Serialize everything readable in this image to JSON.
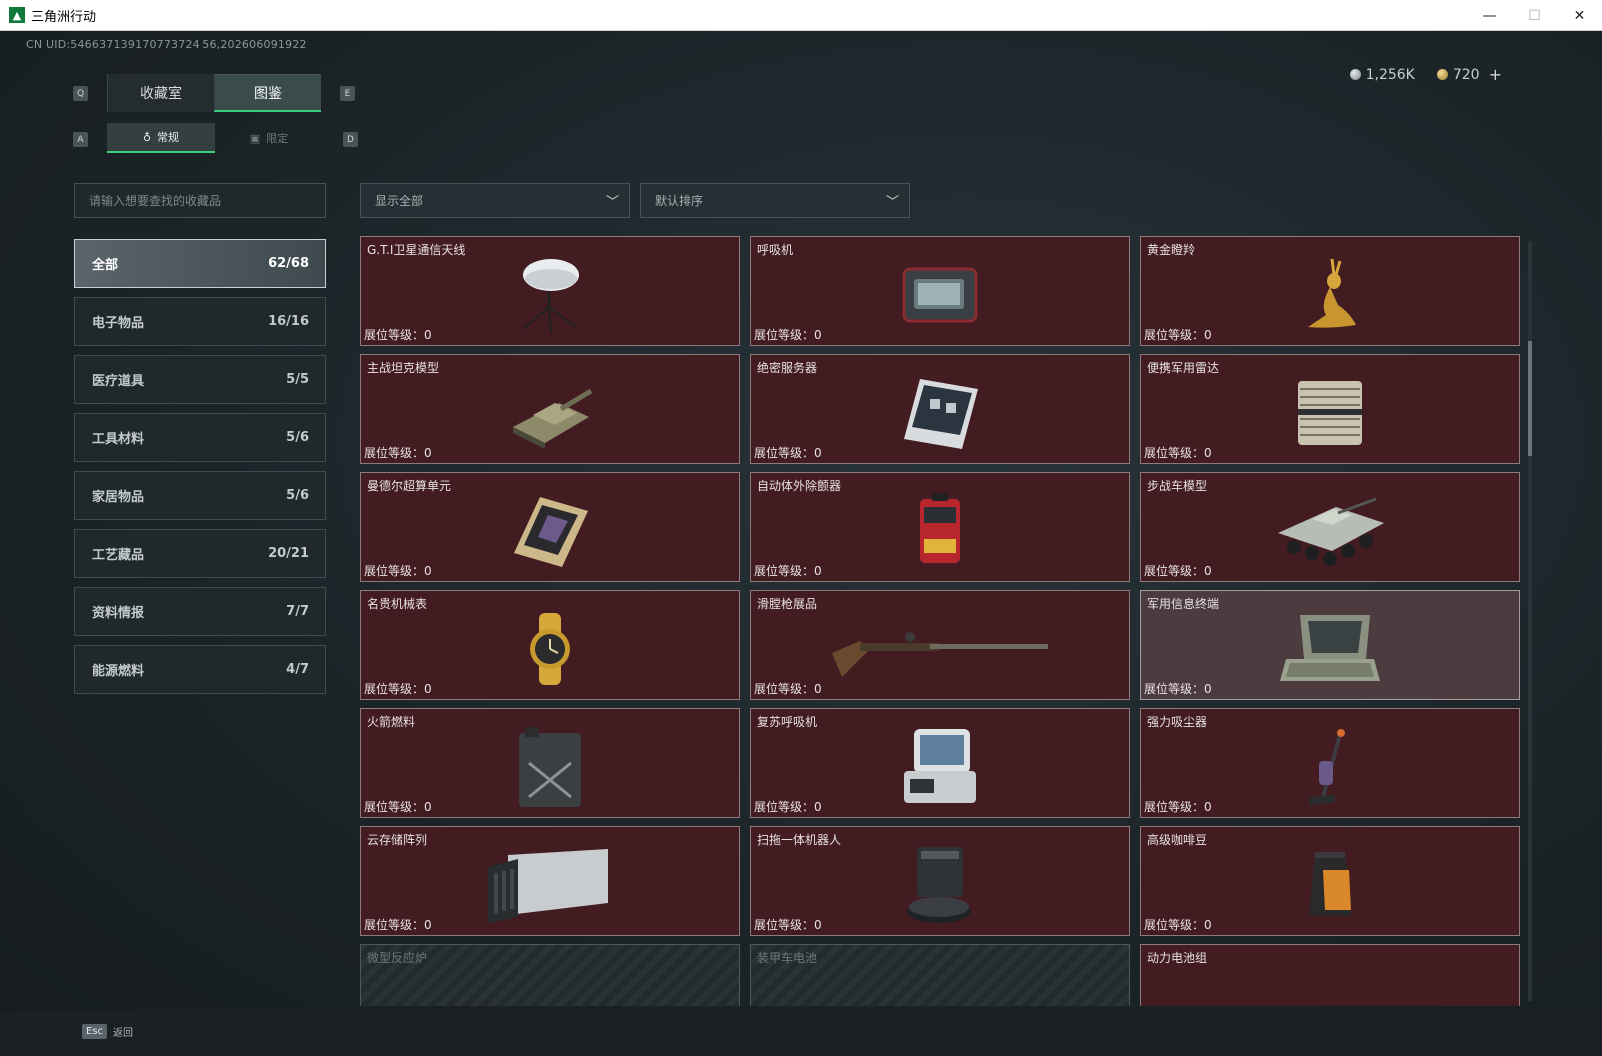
{
  "window": {
    "title": "三角洲行动",
    "minimize": "—",
    "maximize": "☐",
    "close": "✕"
  },
  "uid": "CN UID:546637139170773724 56,202606091922",
  "currency": {
    "silver": "1,256K",
    "gold": "720",
    "plus": "+"
  },
  "keys": {
    "q": "Q",
    "e": "E",
    "a": "A",
    "d": "D"
  },
  "main_tabs": [
    {
      "label": "收藏室"
    },
    {
      "label": "图鉴"
    }
  ],
  "sub_tabs": [
    {
      "label": "常规"
    },
    {
      "label": "限定"
    }
  ],
  "search": {
    "placeholder": "请输入想要查找的收藏品"
  },
  "filters": {
    "show": "显示全部",
    "sort": "默认排序"
  },
  "categories": [
    {
      "label": "全部",
      "count": "62/68"
    },
    {
      "label": "电子物品",
      "count": "16/16"
    },
    {
      "label": "医疗道具",
      "count": "5/5"
    },
    {
      "label": "工具材料",
      "count": "5/6"
    },
    {
      "label": "家居物品",
      "count": "5/6"
    },
    {
      "label": "工艺藏品",
      "count": "20/21"
    },
    {
      "label": "资料情报",
      "count": "7/7"
    },
    {
      "label": "能源燃料",
      "count": "4/7"
    }
  ],
  "items": [
    {
      "name": "G.T.I卫星通信天线",
      "level": "展位等级：0",
      "icon": "satellite-dish-icon"
    },
    {
      "name": "呼吸机",
      "level": "展位等级：0",
      "icon": "ventilator-icon"
    },
    {
      "name": "黄金瞪羚",
      "level": "展位等级：0",
      "icon": "golden-gazelle-icon"
    },
    {
      "name": "主战坦克模型",
      "level": "展位等级：0",
      "icon": "tank-model-icon"
    },
    {
      "name": "绝密服务器",
      "level": "展位等级：0",
      "icon": "server-icon"
    },
    {
      "name": "便携军用雷达",
      "level": "展位等级：0",
      "icon": "radar-icon"
    },
    {
      "name": "曼德尔超算单元",
      "level": "展位等级：0",
      "icon": "supercomputer-unit-icon"
    },
    {
      "name": "自动体外除颤器",
      "level": "展位等级：0",
      "icon": "defibrillator-icon"
    },
    {
      "name": "步战车模型",
      "level": "展位等级：0",
      "icon": "ifv-model-icon"
    },
    {
      "name": "名贵机械表",
      "level": "展位等级：0",
      "icon": "watch-icon"
    },
    {
      "name": "滑膛枪展品",
      "level": "展位等级：0",
      "icon": "musket-icon"
    },
    {
      "name": "军用信息终端",
      "level": "展位等级：0",
      "icon": "terminal-icon"
    },
    {
      "name": "火箭燃料",
      "level": "展位等级：0",
      "icon": "fuel-can-icon"
    },
    {
      "name": "复苏呼吸机",
      "level": "展位等级：0",
      "icon": "resuscitator-icon"
    },
    {
      "name": "强力吸尘器",
      "level": "展位等级：0",
      "icon": "vacuum-icon"
    },
    {
      "name": "云存储阵列",
      "level": "展位等级：0",
      "icon": "storage-array-icon"
    },
    {
      "name": "扫拖一体机器人",
      "level": "展位等级：0",
      "icon": "robot-vacuum-icon"
    },
    {
      "name": "高级咖啡豆",
      "level": "展位等级：0",
      "icon": "coffee-bag-icon"
    },
    {
      "name": "微型反应炉",
      "level": "",
      "icon": ""
    },
    {
      "name": "装甲车电池",
      "level": "",
      "icon": ""
    },
    {
      "name": "动力电池组",
      "level": "",
      "icon": "battery-pack-icon"
    }
  ],
  "back": {
    "key": "Esc",
    "label": "返回"
  },
  "colors": {
    "accent": "#3ad17a",
    "card_bg": "#431c22",
    "card_border": "#8d7a7c"
  }
}
